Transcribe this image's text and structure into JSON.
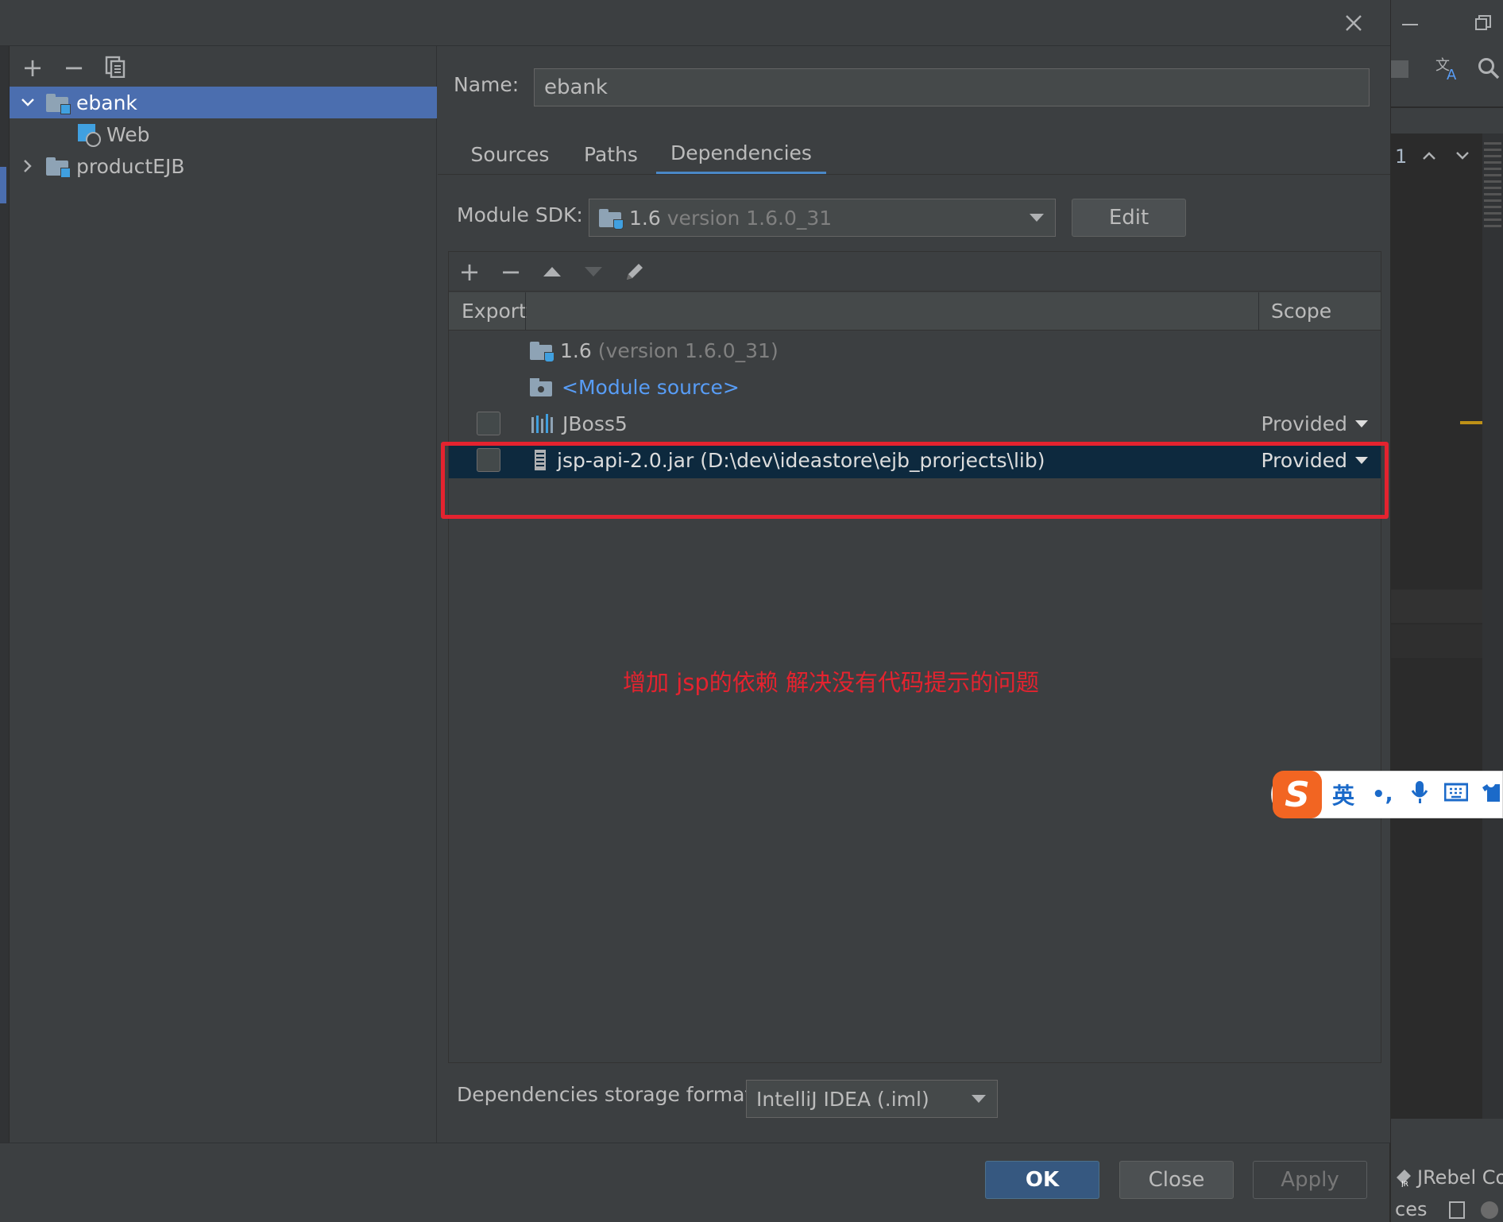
{
  "left_toolbar": {
    "add": "+",
    "remove": "−",
    "copy": "⧉"
  },
  "tree": [
    {
      "label": "ebank",
      "expanded": true,
      "selected": true
    },
    {
      "label": "Web"
    },
    {
      "label": "productEJB",
      "expanded": false
    }
  ],
  "name_field": {
    "label": "Name:",
    "value": "ebank"
  },
  "tabs": [
    {
      "label": "Sources"
    },
    {
      "label": "Paths"
    },
    {
      "label": "Dependencies",
      "active": true
    }
  ],
  "module_sdk": {
    "label": "Module SDK:",
    "selected_main": "1.6",
    "selected_detail": "version 1.6.0_31",
    "edit_label": "Edit"
  },
  "deps_toolbar": {
    "add": "+",
    "remove": "−"
  },
  "deps_table": {
    "export_header": "Export",
    "scope_header": "Scope",
    "rows": [
      {
        "label": "1.6",
        "detail": "(version 1.6.0_31)"
      },
      {
        "label": "<Module source>"
      },
      {
        "label": "JBoss5",
        "scope": "Provided",
        "checked": false
      },
      {
        "label": "jsp-api-2.0.jar",
        "detail": "(D:\\dev\\ideastore\\ejb_prorjects\\lib)",
        "scope": "Provided",
        "checked": false,
        "selected": true
      }
    ]
  },
  "annotation": "增加 jsp的依赖   解决没有代码提示的问题",
  "storage_format": {
    "label": "Dependencies storage format:",
    "value": "IntelliJ IDEA (.iml)"
  },
  "buttons": {
    "ok": "OK",
    "close": "Close",
    "apply": "Apply"
  },
  "ide_background": {
    "line_number": "1",
    "jrebel_label": "JRebel Co",
    "status_fragment": "ces"
  },
  "ime": {
    "lang": "英",
    "punct": "•,",
    "logo": "S"
  },
  "colors": {
    "accent": "#4b6eaf",
    "selection": "#0d293e",
    "annotation": "#e4232f",
    "ok_button": "#365880"
  }
}
